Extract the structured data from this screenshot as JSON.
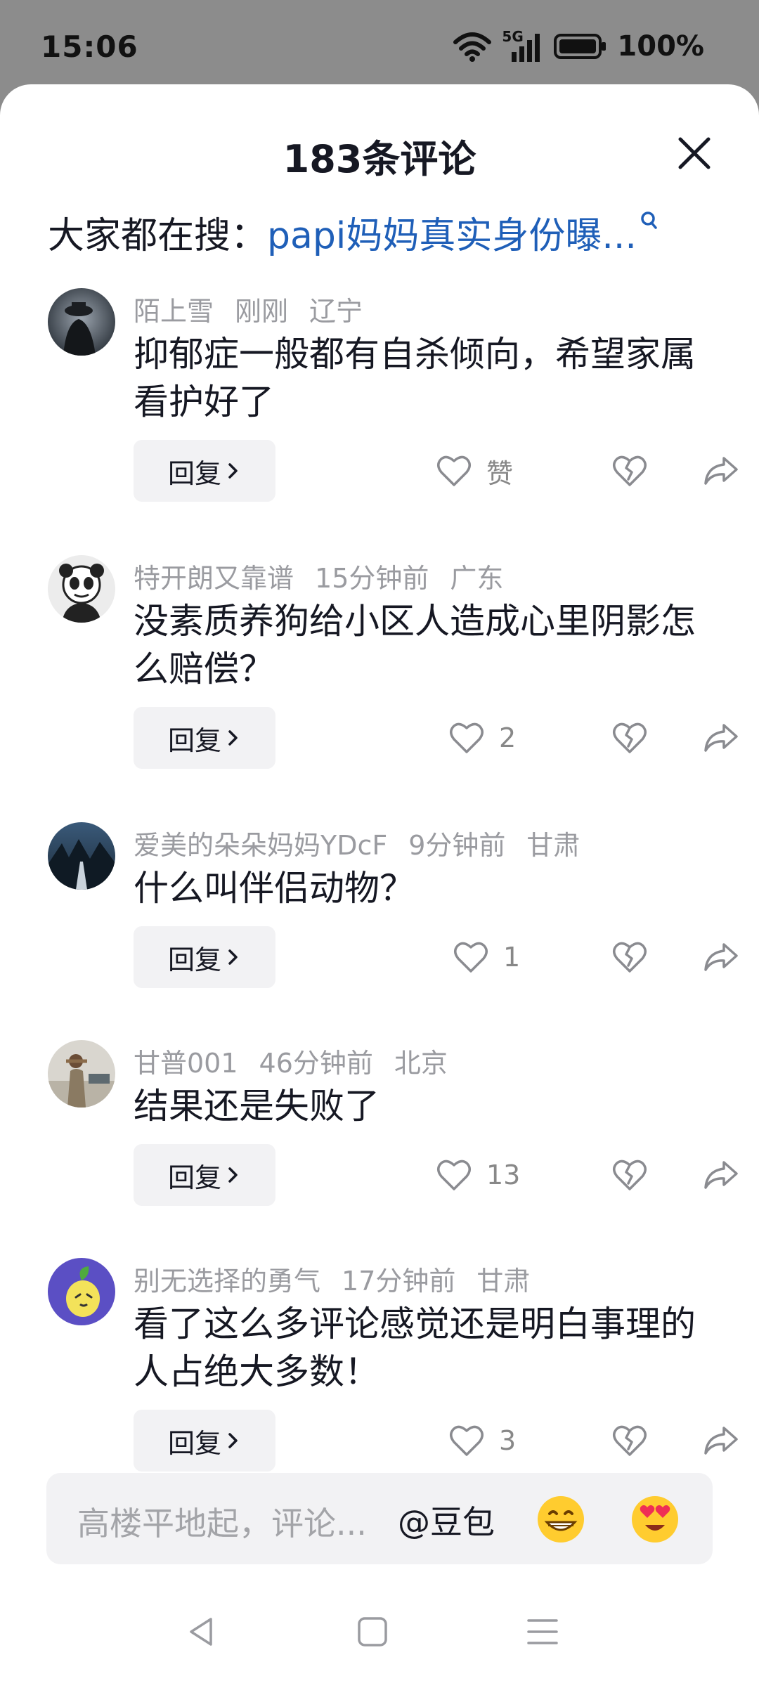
{
  "status_bar": {
    "time": "15:06",
    "network": "5G",
    "battery": "100%"
  },
  "header": {
    "title": "183条评论",
    "close_icon": "close-icon"
  },
  "search": {
    "prefix": "大家都在搜：",
    "query": "papi妈妈真实身份曝..."
  },
  "reply_label": "回复",
  "comments": [
    {
      "username": "陌上雪",
      "time": "刚刚",
      "location": "辽宁",
      "text": "抑郁症一般都有自杀倾向，希望家属看护好了",
      "likes": "赞"
    },
    {
      "username": "特开朗又靠谱",
      "time": "15分钟前",
      "location": "广东",
      "text": "没素质养狗给小区人造成心里阴影怎么赔偿？",
      "likes": "2"
    },
    {
      "username": "爱美的朵朵妈妈YDcF",
      "time": "9分钟前",
      "location": "甘肃",
      "text": "什么叫伴侣动物？",
      "likes": "1"
    },
    {
      "username": "甘普001",
      "time": "46分钟前",
      "location": "北京",
      "text": "结果还是失败了",
      "likes": "13"
    },
    {
      "username": "别无选择的勇气",
      "time": "17分钟前",
      "location": "甘肃",
      "text": "看了这么多评论感觉还是明白事理的人占绝大多数！",
      "likes": "3"
    }
  ],
  "input": {
    "placeholder": "高楼平地起，评论...",
    "mention": "@豆包"
  },
  "colors": {
    "link": "#1f5fb8",
    "meta": "#9a9ba0",
    "text": "#161823"
  }
}
